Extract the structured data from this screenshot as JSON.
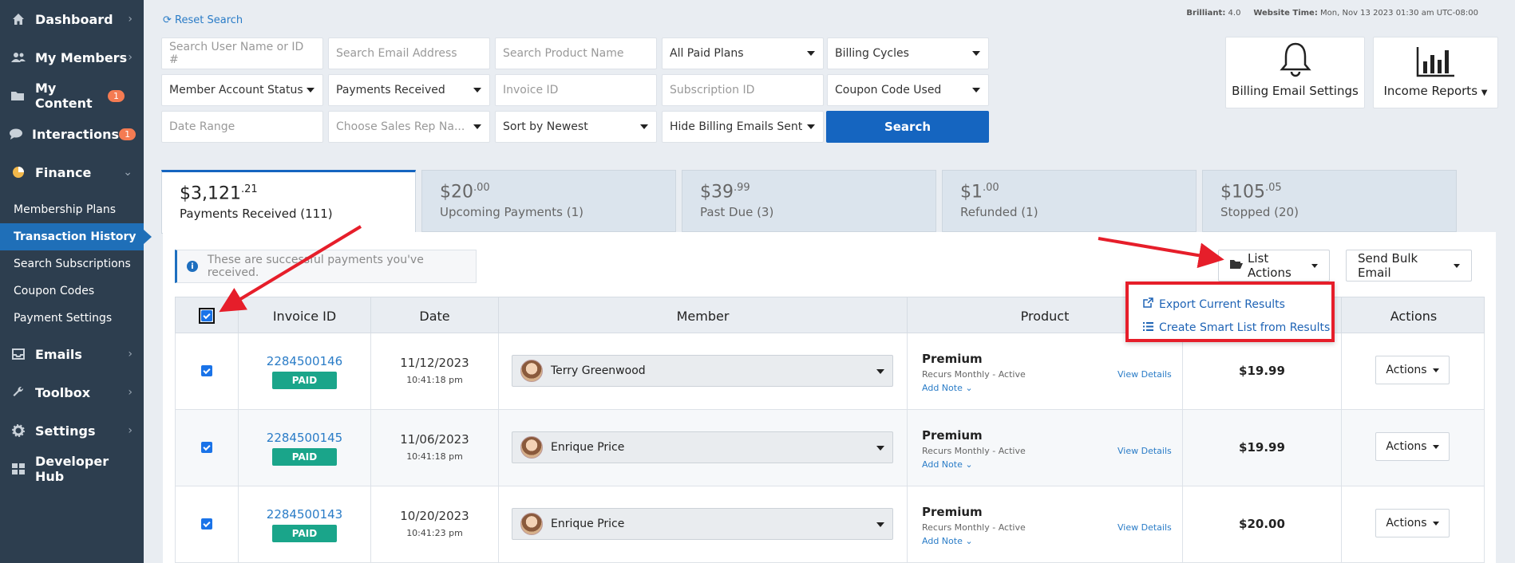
{
  "sidebar": {
    "items": [
      {
        "label": "Dashboard",
        "icon": "home-icon"
      },
      {
        "label": "My Members",
        "icon": "users-icon"
      },
      {
        "label": "My Content",
        "icon": "folder-icon",
        "badge": "1"
      },
      {
        "label": "Interactions",
        "icon": "chat-icon",
        "badge": "1"
      },
      {
        "label": "Finance",
        "icon": "pie-chart-icon",
        "expanded": true
      }
    ],
    "finance_sub": [
      "Membership Plans",
      "Transaction History",
      "Search Subscriptions",
      "Coupon Codes",
      "Payment Settings"
    ],
    "active_sub": "Transaction History",
    "bottom_items": [
      {
        "label": "Emails",
        "icon": "inbox-icon"
      },
      {
        "label": "Toolbox",
        "icon": "wrench-icon"
      },
      {
        "label": "Settings",
        "icon": "gear-icon"
      },
      {
        "label": "Developer Hub",
        "icon": "grid-icon"
      }
    ]
  },
  "header": {
    "reset": "Reset Search",
    "brilliant_label": "Brilliant:",
    "brilliant_value": "4.0",
    "time_label": "Website Time:",
    "time_value": "Mon, Nov 13 2023 01:30 am UTC-08:00"
  },
  "filters": {
    "user": "Search User Name or ID #",
    "email": "Search Email Address",
    "product": "Search Product Name",
    "plans": "All Paid Plans",
    "cycles": "Billing Cycles",
    "status": "Member Account Status",
    "payments": "Payments Received",
    "invoice": "Invoice ID",
    "subscription": "Subscription ID",
    "coupon": "Coupon Code Used",
    "date_range": "Date Range",
    "sales_rep": "Choose Sales Rep Na...",
    "sort": "Sort by Newest",
    "hide_billing": "Hide Billing Emails Sent",
    "search_btn": "Search"
  },
  "tools": {
    "billing_email": "Billing Email Settings",
    "income_reports": "Income Reports"
  },
  "stats": [
    {
      "amount": "$3,121",
      "cents": ".21",
      "label": "Payments Received (111)"
    },
    {
      "amount": "$20",
      "cents": ".00",
      "label": "Upcoming Payments (1)"
    },
    {
      "amount": "$39",
      "cents": ".99",
      "label": "Past Due (3)"
    },
    {
      "amount": "$1",
      "cents": ".00",
      "label": "Refunded (1)"
    },
    {
      "amount": "$105",
      "cents": ".05",
      "label": "Stopped (20)"
    }
  ],
  "info_text": "These are successful payments you've received.",
  "list_actions": "List Actions",
  "send_bulk": "Send Bulk Email",
  "dropdown": {
    "export": "Export Current Results",
    "smart_list": "Create Smart List from Results"
  },
  "table": {
    "headers": {
      "invoice": "Invoice ID",
      "date": "Date",
      "member": "Member",
      "product": "Product",
      "actions": "Actions"
    },
    "rows": [
      {
        "invoice": "2284500146",
        "status": "PAID",
        "date": "11/12/2023",
        "time": "10:41:18 pm",
        "member": "Terry Greenwood",
        "product": "Premium",
        "recurs": "Recurs Monthly - Active",
        "add_note": "Add Note",
        "view": "View Details",
        "amount": "$19.99",
        "action": "Actions"
      },
      {
        "invoice": "2284500145",
        "status": "PAID",
        "date": "11/06/2023",
        "time": "10:41:18 pm",
        "member": "Enrique Price",
        "product": "Premium",
        "recurs": "Recurs Monthly - Active",
        "add_note": "Add Note",
        "view": "View Details",
        "amount": "$19.99",
        "action": "Actions"
      },
      {
        "invoice": "2284500143",
        "status": "PAID",
        "date": "10/20/2023",
        "time": "10:41:23 pm",
        "member": "Enrique Price",
        "product": "Premium",
        "recurs": "Recurs Monthly - Active",
        "add_note": "Add Note",
        "view": "View Details",
        "amount": "$20.00",
        "action": "Actions"
      }
    ]
  },
  "colors": {
    "sidebar": "#2d3e4f",
    "active_nav": "#1f6fb8",
    "primary": "#1565c0",
    "paid": "#1aa58a",
    "annotation": "#e61e2a"
  }
}
